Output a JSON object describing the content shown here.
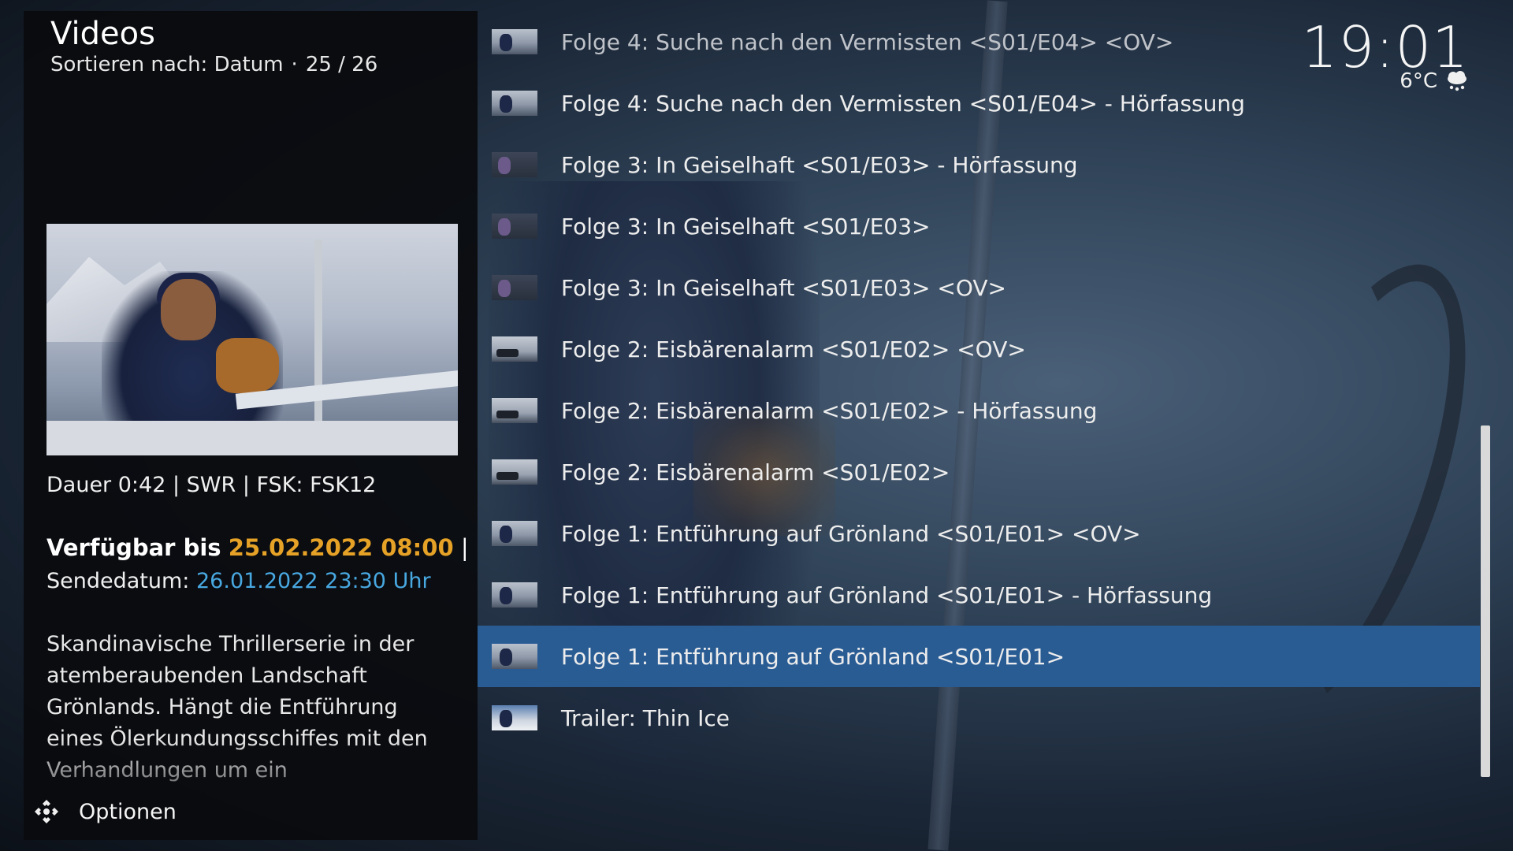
{
  "header": {
    "title": "Videos",
    "sort_label": "Sortieren nach: Datum",
    "separator": "·",
    "position": "25 / 26"
  },
  "clock": {
    "time": "19:01",
    "temperature": "6°C",
    "weather_icon": "cloud-snow-icon"
  },
  "info": {
    "meta": "Dauer 0:42 | SWR | FSK: FSK12",
    "available_label": "Verfügbar bis",
    "available_date": "25.02.2022 08:00",
    "available_sep": "|",
    "broadcast_label": "Sendedatum:",
    "broadcast_date": "26.01.2022 23:30 Uhr",
    "plot": "Skandinavische Thrillerserie in der atemberaubenden Landschaft Grönlands. Hängt die Entführung eines Ölerkundungsschiffes mit den Verhandlungen um ein"
  },
  "options_label": "Optionen",
  "list": {
    "items": [
      {
        "label": "Folge 4: Suche nach den Vermissten <S01/E04> <OV>",
        "thumb": "day"
      },
      {
        "label": "Folge 4: Suche nach den Vermissten <S01/E04> - Hörfassung",
        "thumb": "day"
      },
      {
        "label": "Folge 3: In Geiselhaft <S01/E03> - Hörfassung",
        "thumb": "night"
      },
      {
        "label": "Folge 3: In Geiselhaft <S01/E03>",
        "thumb": "night"
      },
      {
        "label": "Folge 3: In Geiselhaft <S01/E03> <OV>",
        "thumb": "night"
      },
      {
        "label": "Folge 2: Eisbärenalarm <S01/E02> <OV>",
        "thumb": "car"
      },
      {
        "label": "Folge 2: Eisbärenalarm <S01/E02> - Hörfassung",
        "thumb": "car"
      },
      {
        "label": "Folge 2: Eisbärenalarm <S01/E02>",
        "thumb": "car"
      },
      {
        "label": "Folge 1: Entführung auf Grönland <S01/E01> <OV>",
        "thumb": "day"
      },
      {
        "label": "Folge 1: Entführung auf Grönland <S01/E01> - Hörfassung",
        "thumb": "day"
      },
      {
        "label": "Folge 1: Entführung auf Grönland <S01/E01>",
        "thumb": "day"
      },
      {
        "label": "Trailer: Thin Ice",
        "thumb": "trailer"
      }
    ],
    "selected_index": 10
  },
  "colors": {
    "accent_orange": "#e6a227",
    "accent_blue": "#48a8e0",
    "selection": "#2a5c94"
  }
}
